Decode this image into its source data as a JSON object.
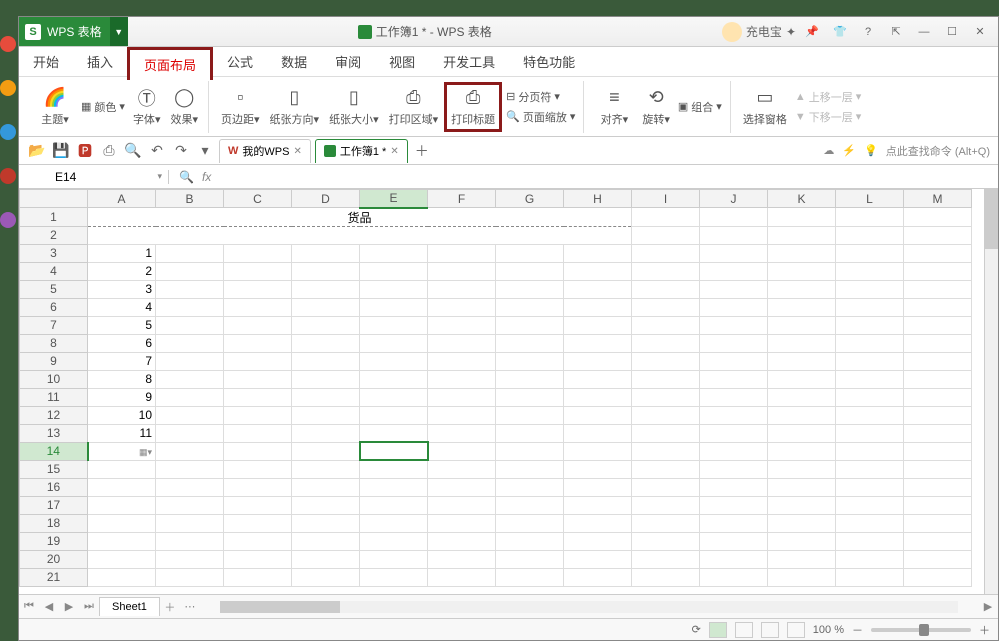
{
  "app": {
    "name": "WPS 表格",
    "logo_letter": "S"
  },
  "title": {
    "doc": "工作簿1 * - WPS 表格"
  },
  "titlebar_right": {
    "user": "充电宝",
    "star": "✦"
  },
  "window_buttons": {
    "export": "⇱",
    "min": "—",
    "max": "☐",
    "close": "✕"
  },
  "menu": {
    "start": "开始",
    "insert": "插入",
    "pagelayout": "页面布局",
    "formula": "公式",
    "data": "数据",
    "review": "审阅",
    "view": "视图",
    "devtools": "开发工具",
    "special": "特色功能"
  },
  "ribbon": {
    "theme": "主题",
    "fontT": "字体",
    "effects": "效果",
    "color": "颜色",
    "margins": "页边距",
    "orientation": "纸张方向",
    "size": "纸张大小",
    "printarea": "打印区域",
    "printtitles": "打印标题",
    "scale": "页面缩放",
    "align": "对齐",
    "rotate": "旋转",
    "selectpane": "选择窗格",
    "pagebreak": "分页符",
    "group": "组合",
    "bringforward": "上移一层",
    "sendback": "下移一层"
  },
  "quickaccess": {
    "mywps": "我的WPS",
    "tab1": "工作簿1 *",
    "searchplaceholder": "点此查找命令 (Alt+Q)"
  },
  "formulabar": {
    "cellref": "E14",
    "fx": "fx"
  },
  "columns": [
    "A",
    "B",
    "C",
    "D",
    "E",
    "F",
    "G",
    "H",
    "I",
    "J",
    "K",
    "L",
    "M"
  ],
  "mergedHeader": "货品",
  "rowdata": [
    "1",
    "2",
    "3",
    "4",
    "5",
    "6",
    "7",
    "8",
    "9",
    "10",
    "11"
  ],
  "sheets": {
    "sheet1": "Sheet1"
  },
  "statusbar": {
    "zoom": "100 %",
    "plus": "＋",
    "minus": "－"
  }
}
